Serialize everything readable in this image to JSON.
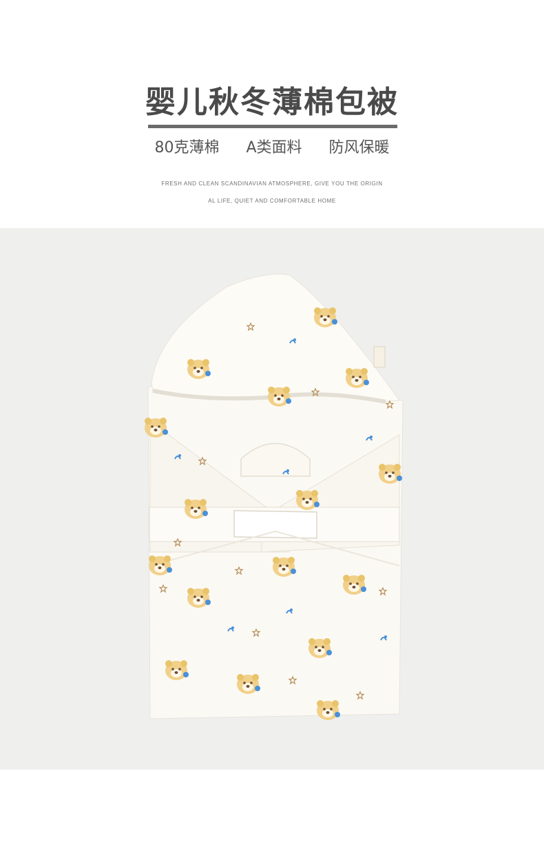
{
  "header": {
    "title": "婴儿秋冬薄棉包被",
    "features": [
      "80克薄棉",
      "A类面料",
      "防风保暖"
    ],
    "tagline_line1": "FRESH AND CLEAN SCANDINAVIAN ATMOSPHERE, GIVE YOU THE ORIGIN",
    "tagline_line2": "AL LIFE, QUIET AND COMFORTABLE HOME"
  },
  "product_photo": {
    "subject": "hooded-baby-swaddle-blanket",
    "colors": {
      "background": "#efefee",
      "fabric": "#fbf9f4",
      "print_bear": "#e9c46a",
      "print_blue": "#4a90d9",
      "print_brown": "#6b4f3a"
    }
  }
}
